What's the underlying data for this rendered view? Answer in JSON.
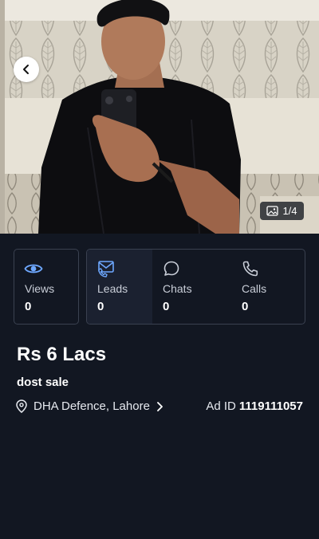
{
  "photo": {
    "counter": "1/4",
    "image_icon": "image-icon",
    "back_icon": "chevron-left-icon"
  },
  "stats": {
    "views": {
      "label": "Views",
      "value": "0",
      "icon": "eye-icon"
    },
    "leads": {
      "label": "Leads",
      "value": "0",
      "icon": "envelope-phone-icon"
    },
    "chats": {
      "label": "Chats",
      "value": "0",
      "icon": "chat-bubble-icon"
    },
    "calls": {
      "label": "Calls",
      "value": "0",
      "icon": "phone-icon"
    }
  },
  "ad": {
    "price": "Rs 6 Lacs",
    "title": "dost sale",
    "location": "DHA Defence, Lahore",
    "ad_id_label": "Ad ID",
    "ad_id_value": "1119111057"
  },
  "colors": {
    "background": "#121722",
    "card_border": "#3a4150",
    "accent_blue": "#6ea8ff"
  }
}
